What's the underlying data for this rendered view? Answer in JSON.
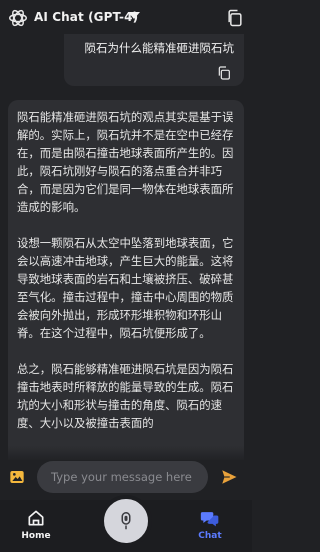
{
  "header": {
    "title": "AI Chat (GPT-4)",
    "logo_icon": "openai-logo-icon",
    "caret_icon": "caret-down-icon",
    "settings_icon": "copy-settings-icon"
  },
  "conversation": {
    "user_message": "陨石为什么能精准砸进陨石坑",
    "assistant_paragraphs": [
      "陨石能精准砸进陨石坑的观点其实是基于误解的。实际上，陨石坑并不是在空中已经存在，而是由陨石撞击地球表面所产生的。因此，陨石坑刚好与陨石的落点重合并非巧合，而是因为它们是同一物体在地球表面所造成的影响。",
      "设想一颗陨石从太空中坠落到地球表面，它会以高速冲击地球，产生巨大的能量。这将导致地球表面的岩石和土壤被挤压、破碎甚至气化。撞击过程中，撞击中心周围的物质会被向外抛出，形成环形堆积物和环形山脊。在这个过程中，陨石坑便形成了。",
      "总之，陨石能够精准砸进陨石坑是因为陨石撞击地表时所释放的能量导致的生成。陨石坑的大小和形状与撞击的角度、陨石的速度、大小以及被撞击表面的"
    ]
  },
  "input": {
    "placeholder": "Type your message here"
  },
  "nav": {
    "home_label": "Home",
    "chat_label": "Chat"
  },
  "colors": {
    "background": "#202124",
    "accent": "#5b7bff",
    "send_accent": "#e9a23b",
    "image_accent": "#f5b83d"
  }
}
